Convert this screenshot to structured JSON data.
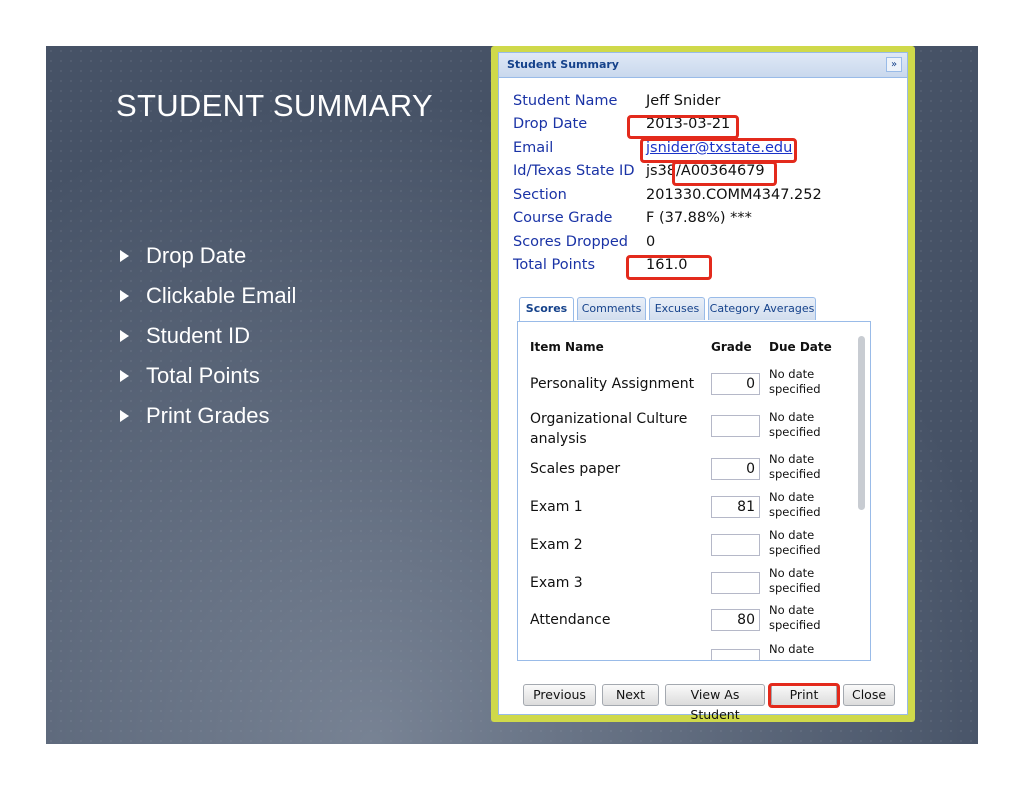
{
  "slide": {
    "title": "STUDENT SUMMARY",
    "bullets": [
      "Drop Date",
      "Clickable Email",
      "Student ID",
      "Total Points",
      "Print Grades"
    ]
  },
  "panel": {
    "title": "Student Summary",
    "collapse_icon": "double-chevron-right-icon",
    "fields": [
      {
        "label": "Student Name",
        "value": "Jeff Snider"
      },
      {
        "label": "Drop Date",
        "value": "2013-03-21"
      },
      {
        "label": "Email",
        "value": "jsnider@txstate.edu"
      },
      {
        "label": "Id/Texas State ID",
        "value": "js38/A00364679"
      },
      {
        "label": "Section",
        "value": "201330.COMM4347.252"
      },
      {
        "label": "Course Grade",
        "value": "F (37.88%) ***"
      },
      {
        "label": "Scores Dropped",
        "value": "0"
      },
      {
        "label": "Total Points",
        "value": "161.0"
      }
    ],
    "tabs": [
      "Scores",
      "Comments",
      "Excuses",
      "Category Averages"
    ],
    "columns": [
      "Item Name",
      "Grade",
      "Due Date"
    ],
    "rows": [
      {
        "name": "Personality Assignment",
        "grade": "0",
        "due": "No date specified"
      },
      {
        "name": "Organizational Culture analysis",
        "grade": "",
        "due": "No date specified"
      },
      {
        "name": "Scales paper",
        "grade": "0",
        "due": "No date specified"
      },
      {
        "name": "Exam 1",
        "grade": "81",
        "due": "No date specified"
      },
      {
        "name": "Exam 2",
        "grade": "",
        "due": "No date specified"
      },
      {
        "name": "Exam 3",
        "grade": "",
        "due": "No date specified"
      },
      {
        "name": "Attendance",
        "grade": "80",
        "due": "No date specified"
      },
      {
        "name": "",
        "grade": "",
        "due": "No date"
      }
    ],
    "buttons": [
      "Previous",
      "Next",
      "View As Student",
      "Print",
      "Close"
    ]
  },
  "colors": {
    "highlight": "#e32a1c",
    "frame": "#cfd94a",
    "label": "#1a33a6"
  }
}
